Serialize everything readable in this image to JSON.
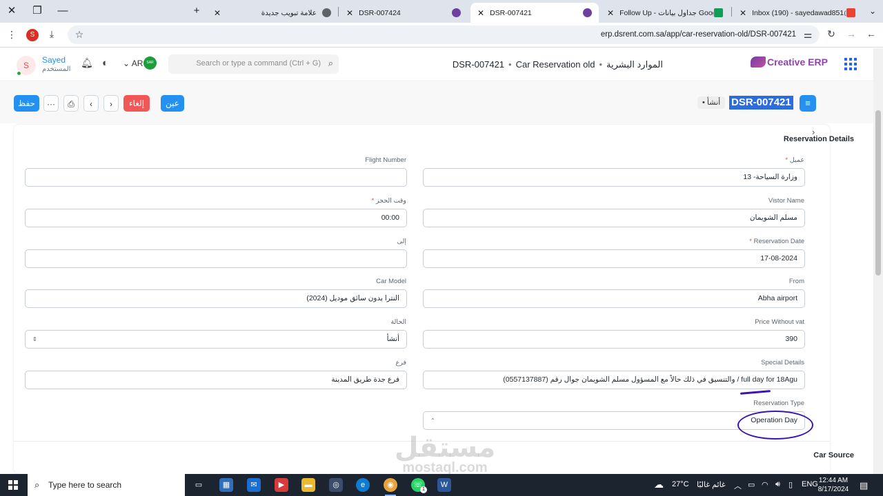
{
  "browser": {
    "tabs": [
      {
        "title": "علامة تبويب جديدة",
        "active": false
      },
      {
        "title": "DSR-007424",
        "active": false
      },
      {
        "title": "DSR-007421",
        "active": true
      },
      {
        "title": "Follow Up - جداول بيانات Googl",
        "active": false
      },
      {
        "title": "Inbox (190) - sayedawad851@g",
        "active": false
      }
    ],
    "url": "erp.dsrent.com.sa/app/car-reservation-old/DSR-007421",
    "profile_initial": "S"
  },
  "navbar": {
    "logo_text": "Creative ERP",
    "breadcrumbs": [
      "الموارد البشرية",
      "Car Reservation old",
      "DSR-007421"
    ],
    "search_placeholder": "Search or type a command (Ctrl + G)",
    "language": "AR",
    "flag_text": "SAR",
    "user_name": "Sayed",
    "user_role": "المستخدم",
    "avatar_initial": "S"
  },
  "page_head": {
    "doc_name": "DSR-007421",
    "status": "أنشأ",
    "save_label": "حفظ",
    "more_label": "···",
    "cancel_label": "إلغاء",
    "assign_label": "عين"
  },
  "form": {
    "section_title": "Reservation Details",
    "fields": {
      "customer": {
        "label": "عميل",
        "required": true,
        "value": "وزارة السياحة- 13"
      },
      "flight_number": {
        "label": "Flight Number",
        "required": false,
        "value": ""
      },
      "visitor_name": {
        "label": "Vistor Name",
        "required": false,
        "value": "مسلم الشويمان"
      },
      "booking_time": {
        "label": "وقت الحجز",
        "required": true,
        "value": "00:00"
      },
      "reservation_date": {
        "label": "Reservation Date",
        "required": true,
        "value": "17-08-2024"
      },
      "to": {
        "label": "إلى",
        "required": false,
        "value": ""
      },
      "from": {
        "label": "From",
        "required": false,
        "value": "Abha airport"
      },
      "car_model": {
        "label": "Car Model",
        "required": false,
        "value": "النترا بدون سائق موديل (2024)"
      },
      "price_without_vat": {
        "label": "Price Without vat",
        "required": false,
        "value": "390"
      },
      "status": {
        "label": "الحالة",
        "required": false,
        "value": "أنشأ"
      },
      "special_details": {
        "label": "Special Details",
        "required": false,
        "value": "full day for 18Agu / والتنسيق في ذلك حالاً مع المسؤول مسلم الشويمان جوال رقم (0557137887)"
      },
      "branch": {
        "label": "فرع",
        "required": false,
        "value": "فرع جدة طريق المدينة"
      },
      "reservation_type": {
        "label": "Reservation Type",
        "required": false,
        "value": "Operation Day"
      }
    },
    "next_section_title": "Car Source",
    "req_mark": "*"
  },
  "watermark": {
    "arabic": "مستقل",
    "latin": "mostaql.com"
  },
  "taskbar": {
    "search_text": "Type here to search",
    "weather": "27°C",
    "weather_desc": "غائم غالبًا",
    "lang": "ENG",
    "time": "12:44 AM",
    "date": "8/17/2024",
    "whatsapp_badge": "1"
  },
  "colors": {
    "primary": "#2490ef",
    "danger": "#f25757",
    "annotation": "#3b15b4"
  }
}
